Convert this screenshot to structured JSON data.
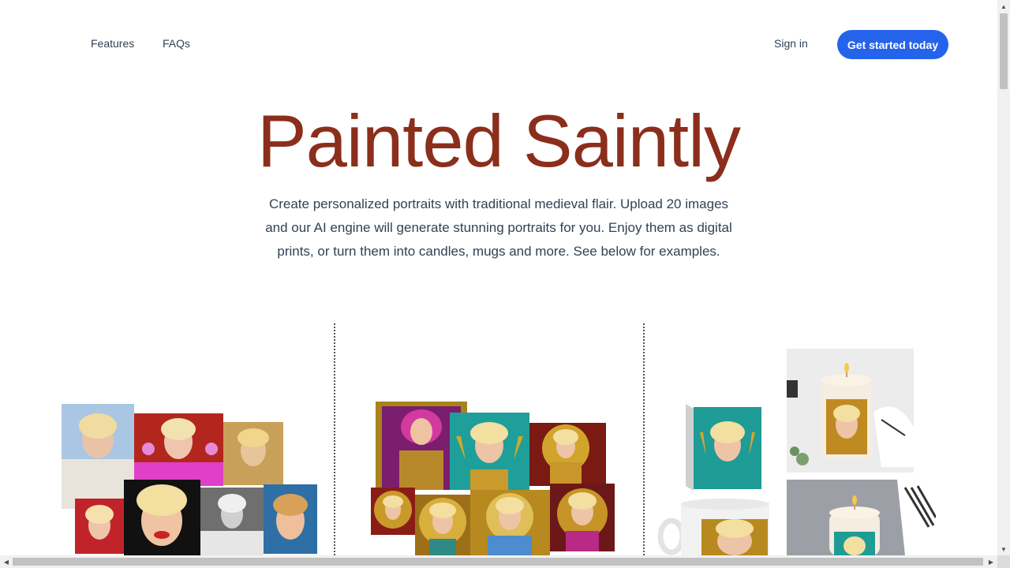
{
  "nav": {
    "links": [
      "Features",
      "FAQs"
    ],
    "signin": "Sign in",
    "cta": "Get started today",
    "cta_color": "#2563eb"
  },
  "hero": {
    "title": "Painted Saintly",
    "title_color": "#8b2e1c",
    "description": "Create personalized portraits with traditional medieval flair. Upload 20 images and our AI engine will generate stunning portraits for you. Enjoy them as digital prints, or turn them into candles, mugs and more. See below for examples."
  },
  "showcase": {
    "columns": [
      {
        "name": "uploaded-photos",
        "image_count": 8
      },
      {
        "name": "generated-portraits",
        "image_count": 8
      },
      {
        "name": "products",
        "items": [
          "canvas-print",
          "mug",
          "candle",
          "candle"
        ]
      }
    ]
  },
  "scrollbar": {
    "up_arrow": "▲",
    "down_arrow": "▼",
    "left_arrow": "◀",
    "right_arrow": "▶"
  }
}
